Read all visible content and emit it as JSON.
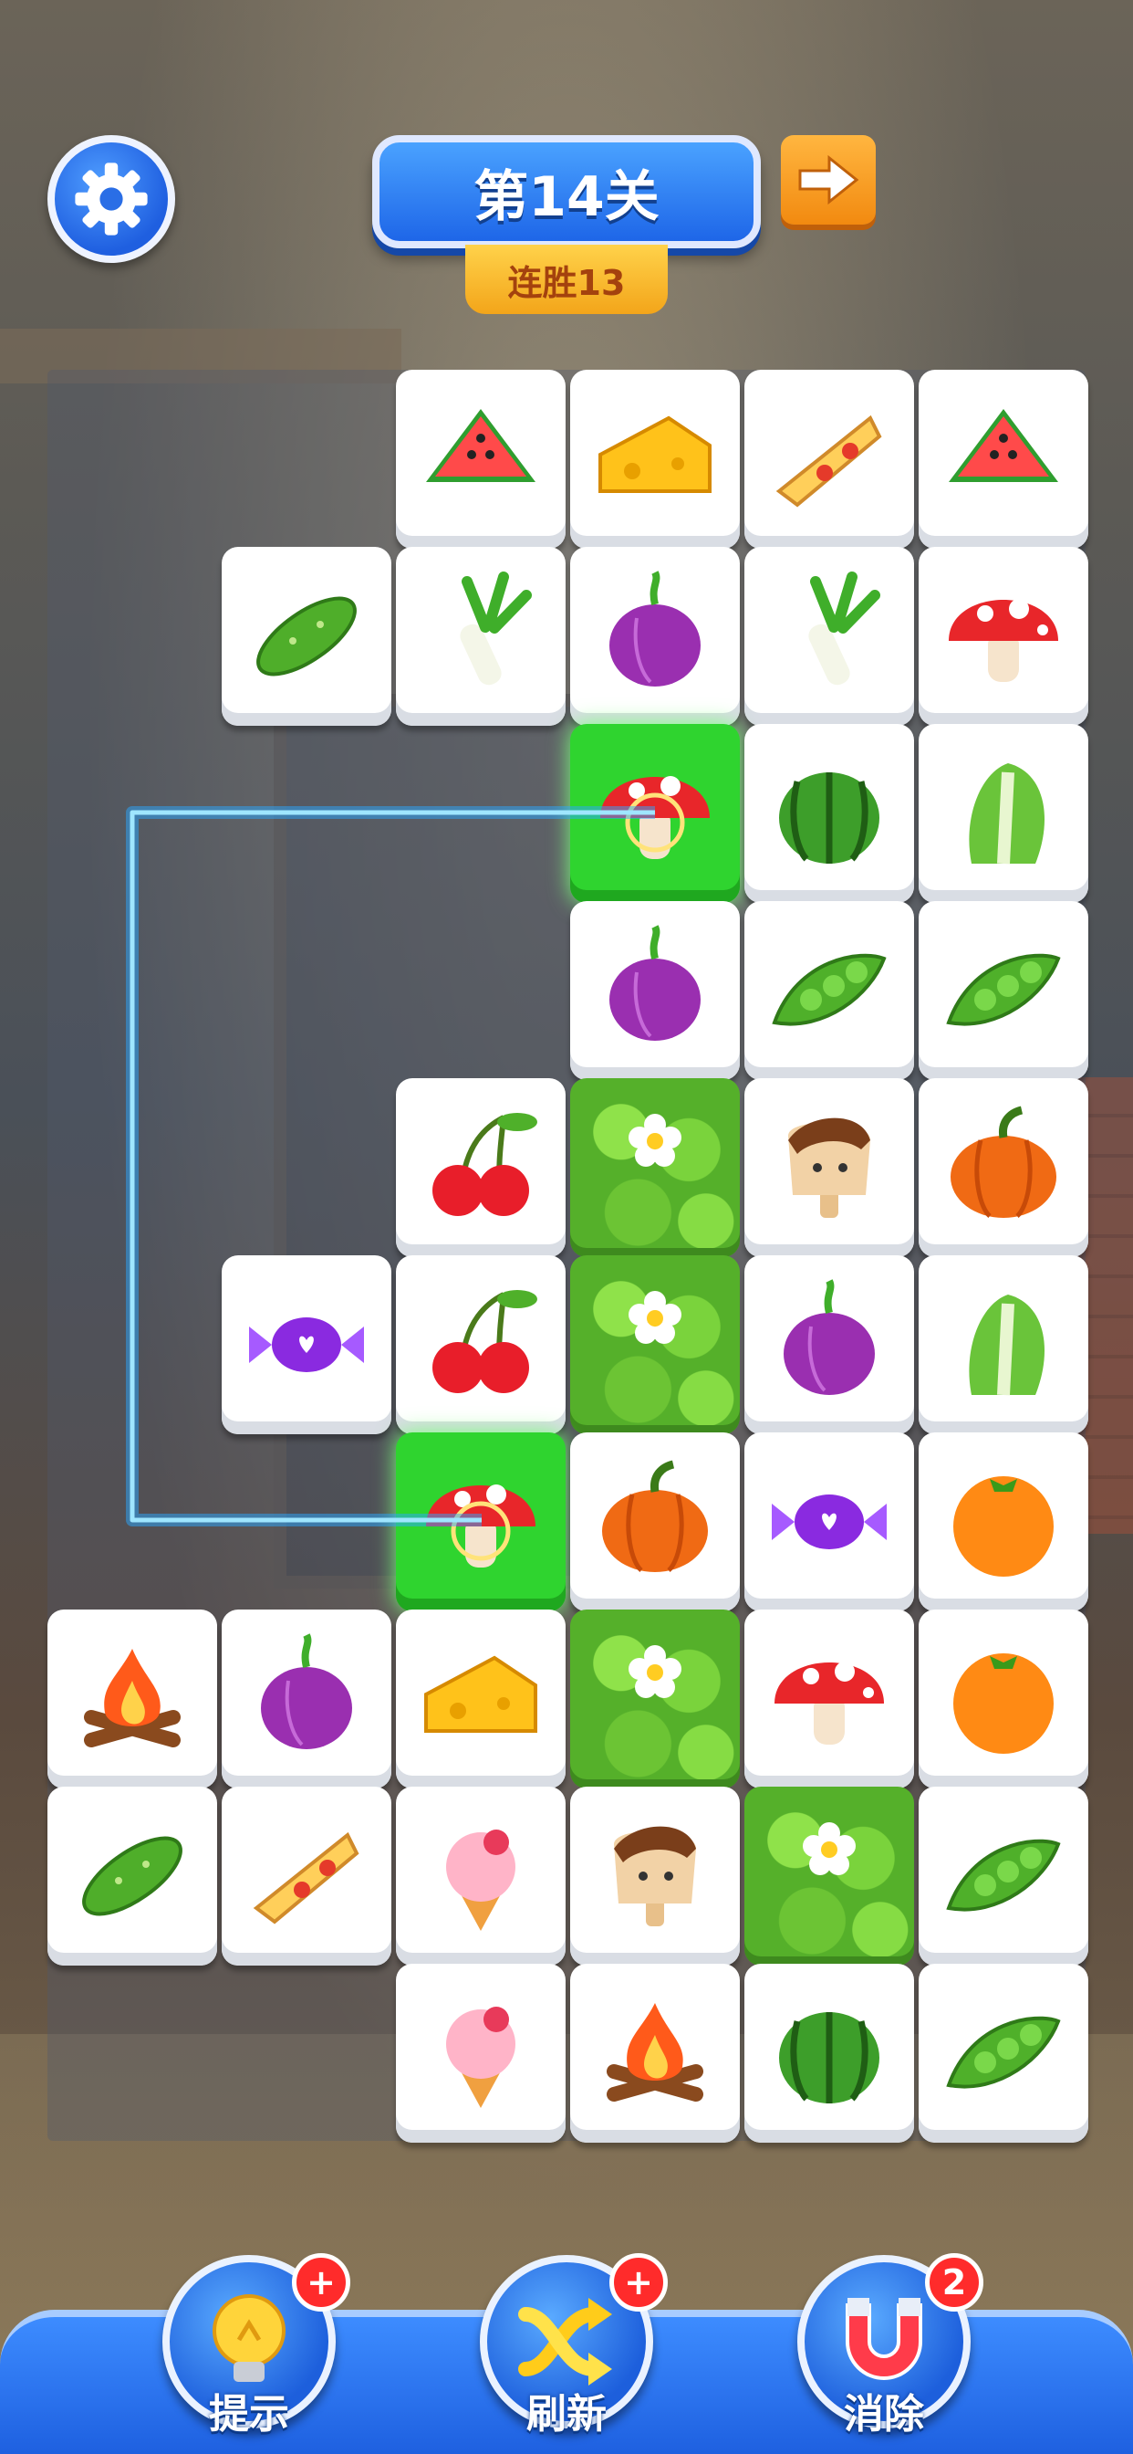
{
  "header": {
    "level_title": "第14关",
    "streak_label": "连胜13"
  },
  "icons": {
    "settings": "gear-icon",
    "next": "arrow-right-icon"
  },
  "board": {
    "rows": [
      [
        "",
        "",
        "watermelon-slice",
        "cheese",
        "pizza",
        "watermelon-slice"
      ],
      [
        "",
        "cucumber",
        "leek",
        "onion",
        "leek",
        "mushroom"
      ],
      [
        "",
        "",
        "",
        "mushroom-selected",
        "watermelon",
        "bok-choy"
      ],
      [
        "",
        "",
        "",
        "onion",
        "peas",
        "peas"
      ],
      [
        "",
        "",
        "cherries",
        "leaf",
        "popsicle",
        "pumpkin"
      ],
      [
        "",
        "candy",
        "cherries",
        "leaf",
        "onion",
        "bok-choy"
      ],
      [
        "",
        "",
        "mushroom-selected",
        "pumpkin",
        "candy",
        "orange"
      ],
      [
        "campfire",
        "onion",
        "cheese",
        "leaf",
        "mushroom",
        "orange"
      ],
      [
        "cucumber",
        "pizza",
        "ice-cream",
        "popsicle",
        "leaf",
        "peas"
      ],
      [
        "",
        "",
        "ice-cream",
        "campfire",
        "watermelon",
        "peas"
      ]
    ]
  },
  "toolbar": {
    "hint_label": "提示",
    "refresh_label": "刷新",
    "remove_label": "消除",
    "remove_count": "2",
    "plus": "+"
  },
  "colors": {
    "primary_blue": "#1e66e8",
    "selected_green": "#2fd42f",
    "path_cyan": "#3fc6ff",
    "streak_orange": "#f3a51a"
  }
}
